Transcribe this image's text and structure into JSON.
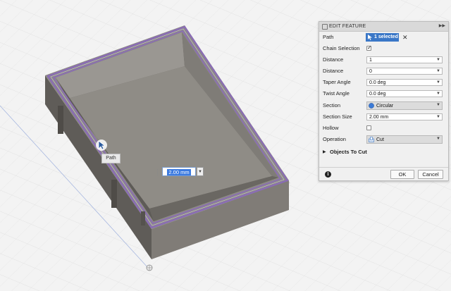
{
  "viewport": {
    "hud_value": "2.00 mm",
    "tooltip": "Path"
  },
  "panel": {
    "title": "EDIT FEATURE",
    "path": {
      "label": "Path",
      "selection": "1 selected"
    },
    "chain_selection": {
      "label": "Chain Selection",
      "checked": true
    },
    "distance_1": {
      "label": "Distance",
      "value": "1"
    },
    "distance_2": {
      "label": "Distance",
      "value": "0"
    },
    "taper_angle": {
      "label": "Taper Angle",
      "value": "0.0 deg"
    },
    "twist_angle": {
      "label": "Twist Angle",
      "value": "0.0 deg"
    },
    "section": {
      "label": "Section",
      "value": "Circular"
    },
    "section_size": {
      "label": "Section Size",
      "value": "2.00 mm"
    },
    "hollow": {
      "label": "Hollow",
      "checked": false
    },
    "operation": {
      "label": "Operation",
      "value": "Cut"
    },
    "objects_to_cut": {
      "label": "Objects To Cut"
    },
    "ok_label": "OK",
    "cancel_label": "Cancel"
  },
  "colors": {
    "selection_blue": "#3a77c7",
    "path_purple": "#8a6bb8",
    "body_gray": "#6e6b66"
  }
}
